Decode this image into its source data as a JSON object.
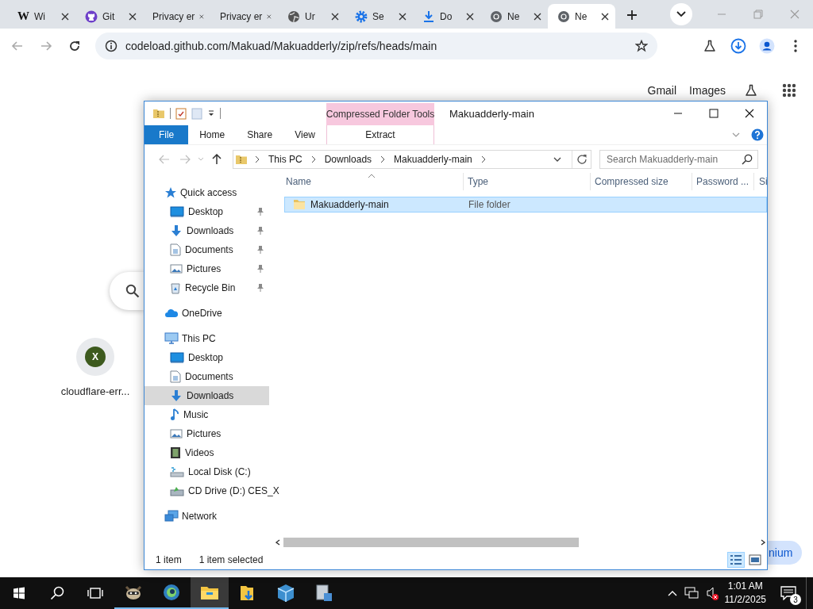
{
  "browser": {
    "tabs": [
      {
        "label": "Wi",
        "kind": "letter",
        "glyph": "W",
        "selected": false
      },
      {
        "label": "Git",
        "kind": "octocat",
        "selected": false
      },
      {
        "label": "Privacy er",
        "kind": "none",
        "selected": false
      },
      {
        "label": "Privacy er",
        "kind": "none",
        "selected": false
      },
      {
        "label": "Ur",
        "kind": "globe",
        "selected": false
      },
      {
        "label": "Se",
        "kind": "gear",
        "selected": false
      },
      {
        "label": "Do",
        "kind": "download",
        "selected": false
      },
      {
        "label": "Ne",
        "kind": "chrome",
        "selected": false
      },
      {
        "label": "Ne",
        "kind": "chrome",
        "selected": true
      }
    ],
    "address": "codeload.github.com/Makuad/Makuadderly/zip/refs/heads/main"
  },
  "new_tab": {
    "links": [
      "Gmail",
      "Images"
    ],
    "shortcut": {
      "glyph": "X",
      "label": "cloudflare-err..."
    },
    "customize_button": "nium"
  },
  "explorer": {
    "title": "Makuadderly-main",
    "context_tab": "Compressed Folder Tools",
    "ribbon_tabs": [
      {
        "label": "File",
        "kind": "file"
      },
      {
        "label": "Home",
        "kind": "tab"
      },
      {
        "label": "Share",
        "kind": "tab"
      },
      {
        "label": "View",
        "kind": "tab"
      },
      {
        "label": "Extract",
        "kind": "context"
      }
    ],
    "path": [
      "This PC",
      "Downloads",
      "Makuadderly-main"
    ],
    "search": {
      "placeholder": "Search Makuadderly-main"
    },
    "nav": [
      {
        "label": "Quick access",
        "kind": "star",
        "selected": false,
        "children": [
          {
            "label": "Desktop",
            "kind": "desktop",
            "selected": false,
            "pinned": true
          },
          {
            "label": "Downloads",
            "kind": "download",
            "selected": false,
            "pinned": true
          },
          {
            "label": "Documents",
            "kind": "document",
            "selected": false,
            "pinned": true
          },
          {
            "label": "Pictures",
            "kind": "pictures",
            "selected": false,
            "pinned": true
          },
          {
            "label": "Recycle Bin",
            "kind": "recycle",
            "selected": false,
            "pinned": true
          }
        ]
      },
      {
        "label": "OneDrive",
        "kind": "cloud",
        "selected": false
      },
      {
        "label": "This PC",
        "kind": "pc",
        "selected": false,
        "children": [
          {
            "label": "Desktop",
            "kind": "desktop",
            "selected": false,
            "pinned": false
          },
          {
            "label": "Documents",
            "kind": "document",
            "selected": false,
            "pinned": false
          },
          {
            "label": "Downloads",
            "kind": "download",
            "selected": true,
            "pinned": false
          },
          {
            "label": "Music",
            "kind": "music",
            "selected": false,
            "pinned": false
          },
          {
            "label": "Pictures",
            "kind": "pictures",
            "selected": false,
            "pinned": false
          },
          {
            "label": "Videos",
            "kind": "video",
            "selected": false,
            "pinned": false
          },
          {
            "label": "Local Disk (C:)",
            "kind": "disk",
            "selected": false,
            "pinned": false
          },
          {
            "label": "CD Drive (D:) CES_X",
            "kind": "cd",
            "selected": false,
            "pinned": false
          }
        ]
      },
      {
        "label": "Network",
        "kind": "network",
        "selected": false
      }
    ],
    "columns": [
      {
        "label": "Name",
        "sorted": true
      },
      {
        "label": "Type",
        "sorted": false
      },
      {
        "label": "Compressed size",
        "sorted": false
      },
      {
        "label": "Password ...",
        "sorted": false
      },
      {
        "label": "Si",
        "sorted": false
      }
    ],
    "rows": [
      {
        "name": "Makuadderly-main",
        "type": "File folder",
        "selected": true
      }
    ],
    "status": {
      "count": "1 item",
      "selection": "1 item selected"
    }
  },
  "taskbar": {
    "apps": [
      {
        "kind": "raccoon",
        "open": true,
        "active": false
      },
      {
        "kind": "orb",
        "open": true,
        "active": false
      },
      {
        "kind": "explorer",
        "open": true,
        "active": true
      },
      {
        "kind": "download-folder",
        "open": false,
        "active": false
      },
      {
        "kind": "cube",
        "open": false,
        "active": false
      },
      {
        "kind": "server",
        "open": false,
        "active": false
      }
    ],
    "volume_muted": true,
    "time": "1:01 AM",
    "date": "11/2/2025",
    "notifications": "3"
  }
}
